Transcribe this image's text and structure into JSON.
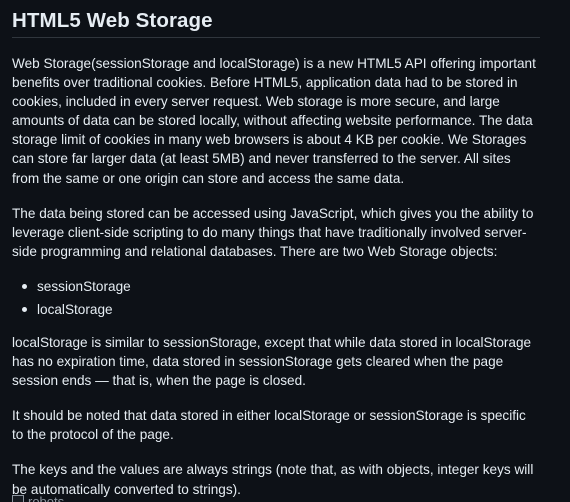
{
  "article": {
    "title": "HTML5 Web Storage",
    "paragraphs": [
      "Web Storage(sessionStorage and localStorage) is a new HTML5 API offering important benefits over traditional cookies. Before HTML5, application data had to be stored in cookies, included in every server request. Web storage is more secure, and large amounts of data can be stored locally, without affecting website performance. The data storage limit of cookies in many web browsers is about 4 KB per cookie. We Storages can store far larger data (at least 5MB) and never transferred to the server. All sites from the same or one origin can store and access the same data.",
      "The data being stored can be accessed using JavaScript, which gives you the ability to leverage client-side scripting to do many things that have traditionally involved server-side programming and relational databases. There are two Web Storage objects:",
      "localStorage is similar to sessionStorage, except that while data stored in localStorage has no expiration time, data stored in sessionStorage gets cleared when the page session ends — that is, when the page is closed.",
      "It should be noted that data stored in either localStorage or sessionStorage is specific to the protocol of the page.",
      "The keys and the values are always strings (note that, as with objects, integer keys will be automatically converted to strings)."
    ],
    "list_items": [
      "sessionStorage",
      "localStorage"
    ],
    "image": {
      "icon": "broken-image-icon",
      "alt_text": "robots"
    }
  }
}
